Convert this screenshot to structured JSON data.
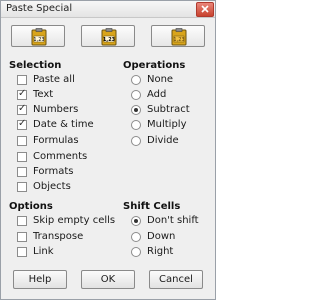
{
  "window": {
    "title": "Paste Special"
  },
  "presets": [
    {
      "name": "values-only",
      "badge": "1,23"
    },
    {
      "name": "values-formats",
      "badge": "1,23"
    },
    {
      "name": "formats-only",
      "badge": "1,23"
    }
  ],
  "selection": {
    "title": "Selection",
    "items": [
      {
        "label": "Paste all",
        "checked": false
      },
      {
        "label": "Text",
        "checked": true
      },
      {
        "label": "Numbers",
        "checked": true
      },
      {
        "label": "Date & time",
        "checked": true
      },
      {
        "label": "Formulas",
        "checked": false
      },
      {
        "label": "Comments",
        "checked": false
      },
      {
        "label": "Formats",
        "checked": false
      },
      {
        "label": "Objects",
        "checked": false
      }
    ]
  },
  "operations": {
    "title": "Operations",
    "items": [
      {
        "label": "None",
        "selected": false
      },
      {
        "label": "Add",
        "selected": false
      },
      {
        "label": "Subtract",
        "selected": true
      },
      {
        "label": "Multiply",
        "selected": false
      },
      {
        "label": "Divide",
        "selected": false
      }
    ]
  },
  "options": {
    "title": "Options",
    "items": [
      {
        "label": "Skip empty cells",
        "checked": false
      },
      {
        "label": "Transpose",
        "checked": false
      },
      {
        "label": "Link",
        "checked": false
      }
    ]
  },
  "shift_cells": {
    "title": "Shift Cells",
    "items": [
      {
        "label": "Don't shift",
        "selected": true
      },
      {
        "label": "Down",
        "selected": false
      },
      {
        "label": "Right",
        "selected": false
      }
    ]
  },
  "buttons": {
    "help": "Help",
    "ok": "OK",
    "cancel": "Cancel"
  },
  "colors": {
    "dialog_bg": "#efefef",
    "close_button": "#c8432f",
    "clipboard": "#d9a41a"
  }
}
